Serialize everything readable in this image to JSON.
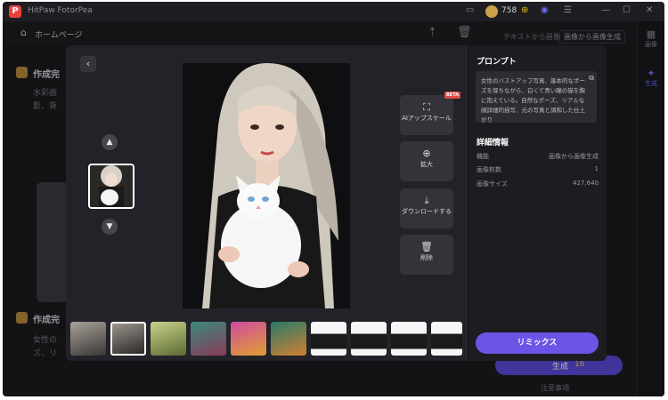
{
  "app": {
    "title": "HitPaw FotorPea",
    "credits": "758"
  },
  "nav": {
    "home_label": "ホームページ"
  },
  "background": {
    "tabs": [
      "テキストから画像",
      "画像から画像生成"
    ],
    "card1_title": "作成完",
    "card1_text_a": "水彩画",
    "card1_text_b": "影、背",
    "card2_title": "作成完",
    "card2_text_a": "女性の",
    "card2_text_b": "ズ、リ",
    "right_items": [
      "画像",
      "生成"
    ],
    "generate_label": "生成",
    "generate_cost": "16",
    "generate_note": "注意事項"
  },
  "modal": {
    "actions": [
      {
        "label": "AIアップスケール",
        "icon": "upscale-icon"
      },
      {
        "label": "拡大",
        "icon": "zoom-icon"
      },
      {
        "label": "ダウンロードする",
        "icon": "download-icon"
      },
      {
        "label": "削除",
        "icon": "trash-icon"
      }
    ],
    "beta_badge": "BETA",
    "prompt_title": "プロンプト",
    "prompt_text": "女性のバストアップ写真、基本的なポーズを保ちながら、白くて青い瞳の猫を胸に抱えている。自然なポーズ、リアルな顔詳細的描写、元の写真と調和した仕上がり",
    "details_title": "詳細情報",
    "details": [
      {
        "label": "機能",
        "value": "画像から画像生成"
      },
      {
        "label": "画像枚数",
        "value": "1"
      },
      {
        "label": "画像サイズ",
        "value": "427,640"
      }
    ],
    "remix_label": "リミックス"
  }
}
